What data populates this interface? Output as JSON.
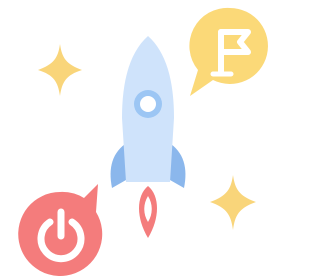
{
  "illustration": {
    "elements": [
      "rocket-icon",
      "flag-icon",
      "power-icon",
      "sparkle-icon"
    ]
  },
  "colors": {
    "rocket_body": "#cfe3fb",
    "rocket_window_ring": "#9cc6f4",
    "rocket_fins": "#8bb7ec",
    "rocket_flame": "#f47c7c",
    "flag_bubble": "#fbd978",
    "power_bubble": "#f47c7c",
    "sparkle": "#f9d57a",
    "icon_stroke": "#ffffff"
  }
}
